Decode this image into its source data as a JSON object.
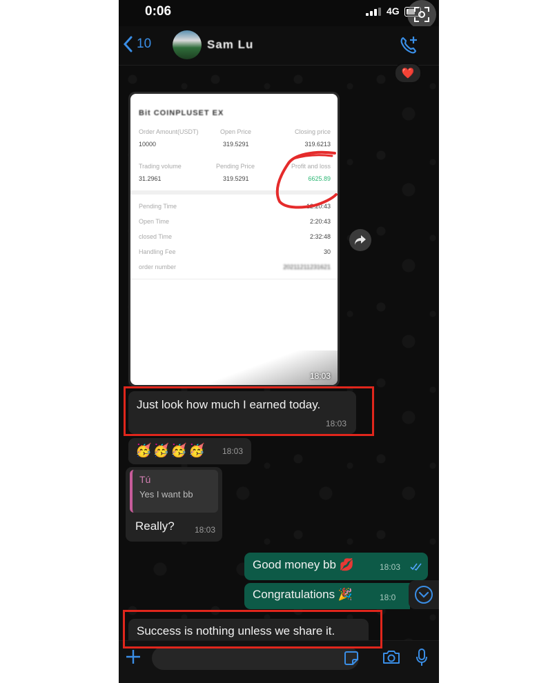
{
  "status_bar": {
    "time": "0:06",
    "network": "4G"
  },
  "header": {
    "back_count": "10",
    "contact_name": "Sam Lu"
  },
  "reaction": "❤️",
  "receipt": {
    "heading": "Bit COINPLUSET EX",
    "fields": {
      "order_amount_label": "Order Amount(USDT)",
      "order_amount": "10000",
      "open_price_label": "Open Price",
      "open_price": "319.5291",
      "closing_price_label": "Closing price",
      "closing_price": "319.6213",
      "trading_volume_label": "Trading volume",
      "trading_volume": "31.2961",
      "pending_price_label": "Pending Price",
      "pending_price": "319.5291",
      "profit_loss_label": "Profit and loss",
      "profit_loss": "6625.89",
      "pending_time_label": "Pending Time",
      "pending_time": "12:20:43",
      "open_time_label": "Open Time",
      "open_time": "2:20:43",
      "closed_time_label": "closed Time",
      "closed_time": "2:32:48",
      "handling_fee_label": "Handling Fee",
      "handling_fee": "30",
      "order_number_label": "order number",
      "order_number": "20211211231621"
    },
    "timestamp": "18:03"
  },
  "messages": [
    {
      "text": "Just look how much I earned today.",
      "time": "18:03"
    },
    {
      "text": "🥳🥳🥳🥳",
      "time": "18:03"
    },
    {
      "quote_author": "Tú",
      "quote_text": "Yes I want bb",
      "text": "Really?",
      "time": "18:03"
    },
    {
      "text": "Good money bb 💋",
      "time": "18:03"
    },
    {
      "text": "Congratulations 🎉",
      "time": "18:0"
    },
    {
      "text": "Success is nothing unless we share it."
    }
  ],
  "colors": {
    "accent": "#3a8ee6",
    "outgoing": "#0d5a47",
    "incoming": "#232323",
    "annotation": "#e0261c"
  }
}
